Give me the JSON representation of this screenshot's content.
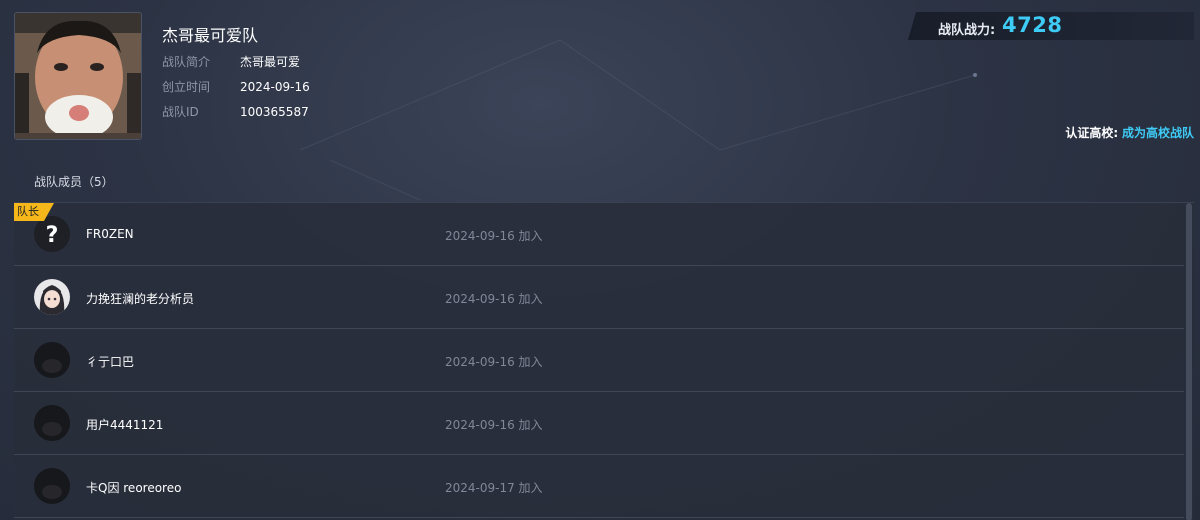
{
  "team": {
    "name": "杰哥最可爱队",
    "intro_label": "战队简介",
    "intro_value": "杰哥最可爱",
    "created_label": "创立时间",
    "created_value": "2024-09-16",
    "id_label": "战队ID",
    "id_value": "100365587"
  },
  "power": {
    "label": "战队战力:",
    "value": "4728",
    "accent_color": "#3ecbf5"
  },
  "school": {
    "label": "认证高校:",
    "link": "成为高校战队"
  },
  "members": {
    "title": "战队成员（5）",
    "captain_badge": "队长",
    "list": [
      {
        "name": "FR0ZEN",
        "joined": "2024-09-16 加入",
        "avatar": "question-mark-avatar-icon"
      },
      {
        "name": "力挽狂澜的老分析员",
        "joined": "2024-09-16 加入",
        "avatar": "anime-girl-avatar-icon"
      },
      {
        "name": "彳亍口巴",
        "joined": "2024-09-16 加入",
        "avatar": "dark-avatar-icon"
      },
      {
        "name": "用户4441121",
        "joined": "2024-09-16 加入",
        "avatar": "dark-avatar-icon"
      },
      {
        "name": "卡Q因 reoreoreo",
        "joined": "2024-09-17 加入",
        "avatar": "dark-avatar-icon"
      }
    ]
  }
}
